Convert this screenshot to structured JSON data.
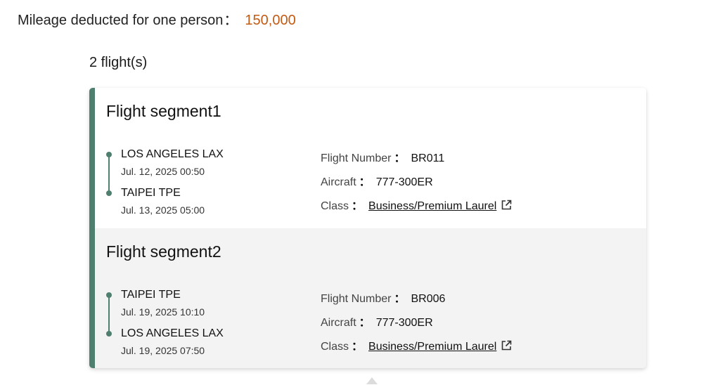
{
  "mileage": {
    "label": "Mileage deducted for one person",
    "separator": "：",
    "value": "150,000"
  },
  "flights_count": "2 flight(s)",
  "labels": {
    "flight_number": "Flight Number",
    "aircraft": "Aircraft",
    "class": "Class",
    "colon": "："
  },
  "segments": [
    {
      "title": "Flight segment1",
      "departure": {
        "city": "LOS ANGELES LAX",
        "time": "Jul. 12, 2025 00:50"
      },
      "arrival": {
        "city": "TAIPEI TPE",
        "time": "Jul. 13, 2025 05:00"
      },
      "flight_number": "BR011",
      "aircraft": "777-300ER",
      "class": "Business/Premium Laurel"
    },
    {
      "title": "Flight segment2",
      "departure": {
        "city": "TAIPEI TPE",
        "time": "Jul. 19, 2025 10:10"
      },
      "arrival": {
        "city": "LOS ANGELES LAX",
        "time": "Jul. 19, 2025 07:50"
      },
      "flight_number": "BR006",
      "aircraft": "777-300ER",
      "class": "Business/Premium Laurel"
    }
  ],
  "colors": {
    "accent": "#4f7f6e",
    "mileage_value": "#c25a14",
    "segment_alt_bg": "#f3f3f3"
  },
  "icons": {
    "class_link": "external-link-icon",
    "route_point": "route-dot-icon",
    "scroll": "caret-up-icon"
  }
}
